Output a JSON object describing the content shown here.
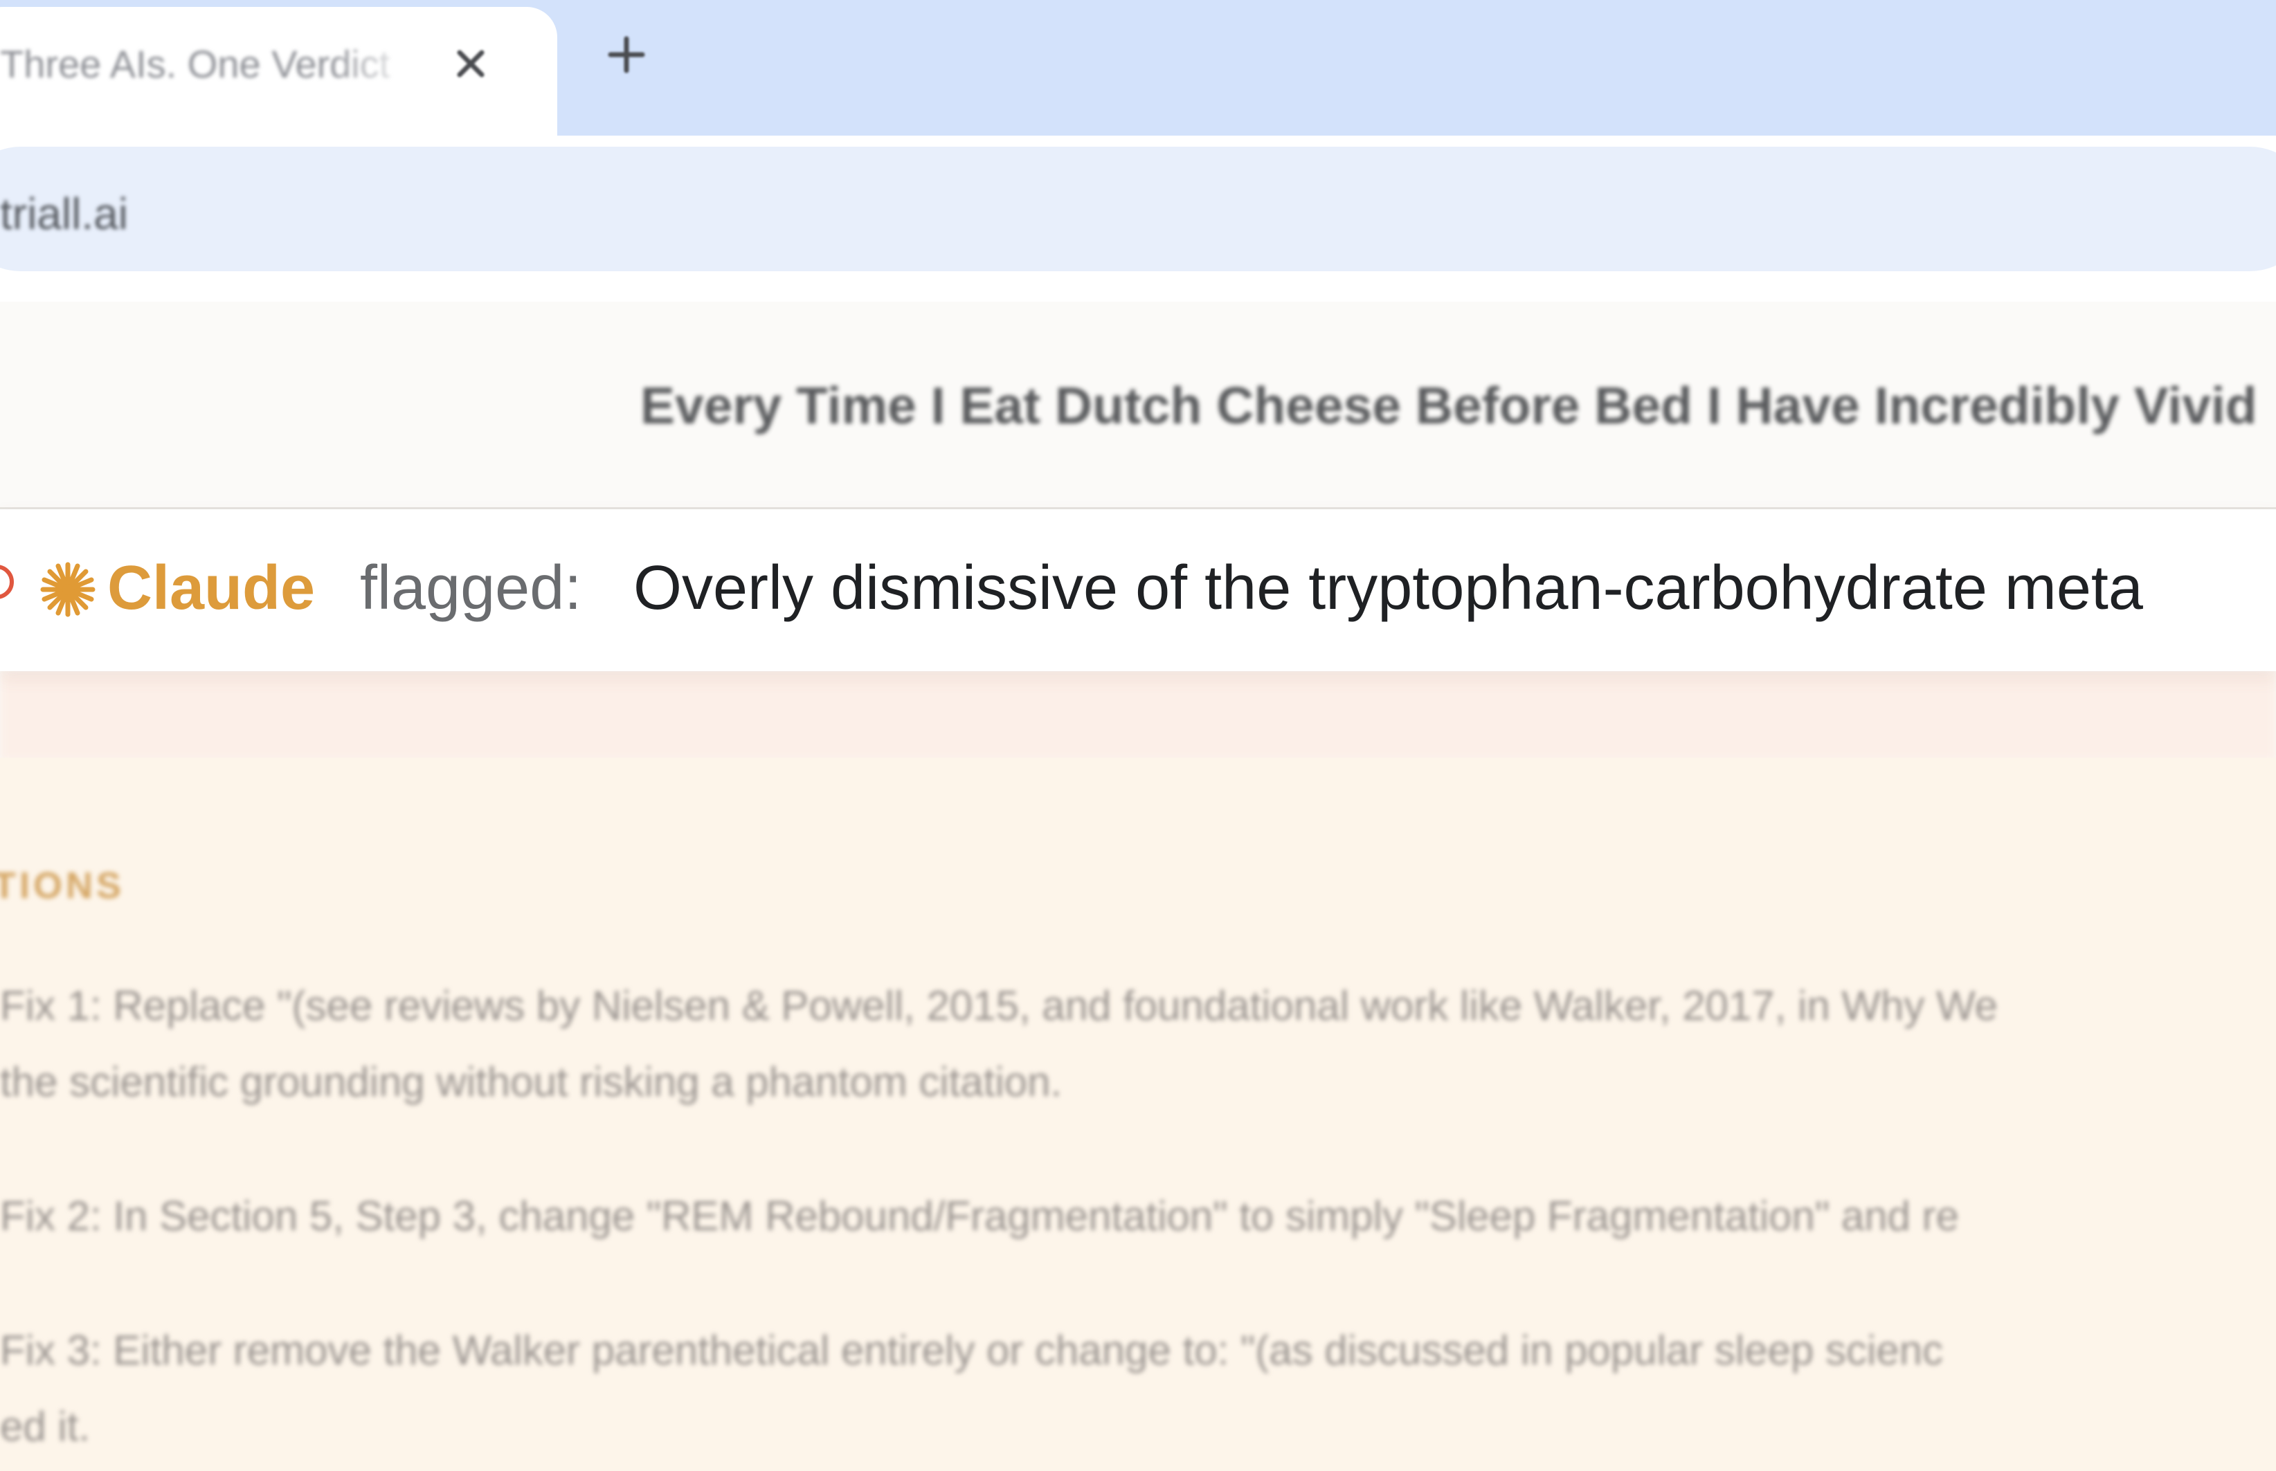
{
  "browser": {
    "tab": {
      "title": "Three AIs. One Verdict"
    },
    "address_bar": {
      "url": "triall.ai"
    }
  },
  "page": {
    "doc_title": "Every Time I Eat Dutch Cheese Before Bed I Have Incredibly Vivid",
    "flag": {
      "reviewer": "Claude",
      "label": "flagged:",
      "text": "Overly dismissive of the tryptophan-carbohydrate meta"
    },
    "section_label": "TIONS",
    "fixes": [
      "Fix 1: Replace \"(see reviews by Nielsen & Powell, 2015, and foundational work like Walker, 2017, in Why We",
      "the scientific grounding without risking a phantom citation.",
      "Fix 2: In Section 5, Step 3, change \"REM Rebound/Fragmentation\" to simply \"Sleep Fragmentation\" and re",
      "Fix 3: Either remove the Walker parenthetical entirely or change to: \"(as discussed in popular sleep scienc",
      "ed it."
    ]
  },
  "colors": {
    "tabstrip": "#d3e2fb",
    "omnibox": "#e8effb",
    "claude_accent": "#dd9b3b",
    "status_dot": "#e0573f",
    "section_label": "#d5a766",
    "content_bg": "#fdf5ea"
  },
  "icons": {
    "tab_close": "close-icon",
    "new_tab": "plus-icon",
    "reviewer": "claude-starburst-icon",
    "status": "status-circle-icon"
  }
}
